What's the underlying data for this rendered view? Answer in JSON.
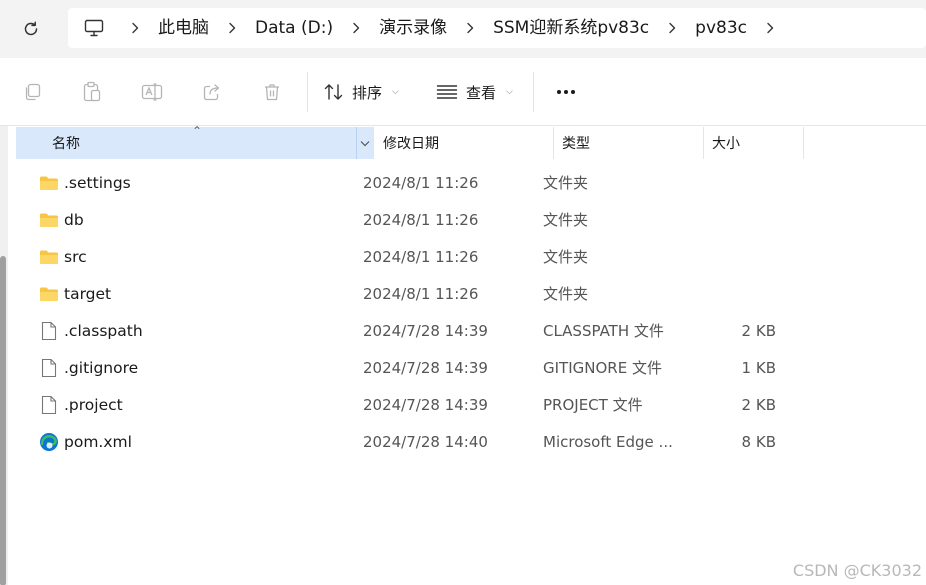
{
  "breadcrumb": {
    "items": [
      "此电脑",
      "Data (D:)",
      "演示录像",
      "SSM迎新系统pv83c",
      "pv83c"
    ]
  },
  "commandbar": {
    "sort_label": "排序",
    "view_label": "查看"
  },
  "columns": {
    "name": "名称",
    "date": "修改日期",
    "type": "类型",
    "size": "大小"
  },
  "files": [
    {
      "name": ".settings",
      "date": "2024/8/1 11:26",
      "type": "文件夹",
      "size": "",
      "icon": "folder-icon"
    },
    {
      "name": "db",
      "date": "2024/8/1 11:26",
      "type": "文件夹",
      "size": "",
      "icon": "folder-icon"
    },
    {
      "name": "src",
      "date": "2024/8/1 11:26",
      "type": "文件夹",
      "size": "",
      "icon": "folder-icon"
    },
    {
      "name": "target",
      "date": "2024/8/1 11:26",
      "type": "文件夹",
      "size": "",
      "icon": "folder-icon"
    },
    {
      "name": ".classpath",
      "date": "2024/7/28 14:39",
      "type": "CLASSPATH 文件",
      "size": "2 KB",
      "icon": "file-icon"
    },
    {
      "name": ".gitignore",
      "date": "2024/7/28 14:39",
      "type": "GITIGNORE 文件",
      "size": "1 KB",
      "icon": "file-icon"
    },
    {
      "name": ".project",
      "date": "2024/7/28 14:39",
      "type": "PROJECT 文件",
      "size": "2 KB",
      "icon": "file-icon"
    },
    {
      "name": "pom.xml",
      "date": "2024/7/28 14:40",
      "type": "Microsoft Edge ...",
      "size": "8 KB",
      "icon": "edge-icon"
    }
  ],
  "watermark": "CSDN @CK3032",
  "colors": {
    "folder": "#f7c644",
    "selected_header": "#d9e8fb",
    "edge_blue": "#0c74d4",
    "edge_green": "#3bbf5a"
  }
}
